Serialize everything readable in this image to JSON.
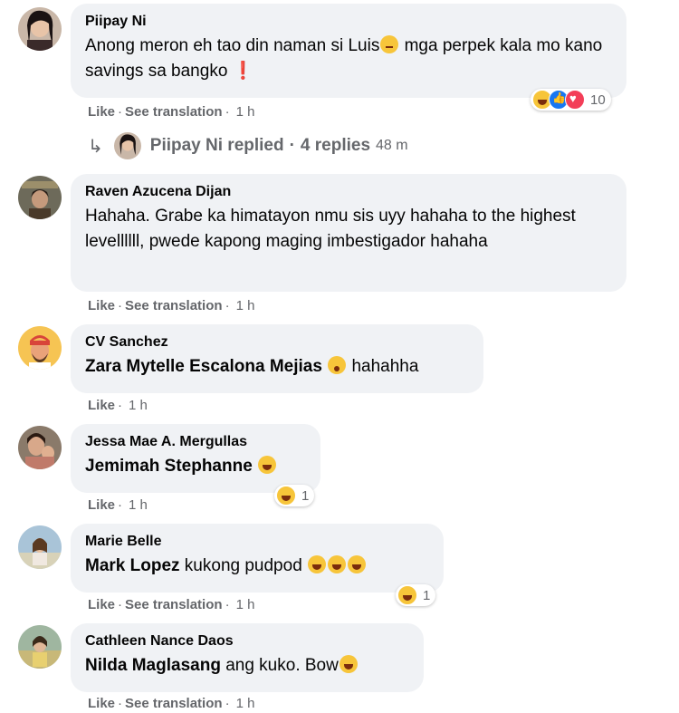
{
  "comments": [
    {
      "author": "Piipay Ni",
      "text_before": "Anong meron eh tao din naman si Luis",
      "text_after": " mga perpek kala mo kano savings sa bangko",
      "trailing": "❗",
      "reactions_count": "10",
      "actions": {
        "like": "Like",
        "translate": "See translation",
        "time": "1 h"
      },
      "reply_summary": {
        "author": "Piipay Ni replied",
        "replies": "4 replies",
        "time": "48 m"
      }
    },
    {
      "author": "Raven Azucena Dijan",
      "text": "Hahaha. Grabe ka himatayon nmu sis uyy hahaha to the highest levellllll, pwede kapong maging imbestigador hahaha",
      "actions": {
        "like": "Like",
        "translate": "See translation",
        "time": "1 h"
      }
    },
    {
      "author": "CV Sanchez",
      "mention": "Zara Mytelle Escalona Mejias",
      "text": " hahahha",
      "actions": {
        "like": "Like",
        "time": "1 h"
      }
    },
    {
      "author": "Jessa Mae A. Mergullas",
      "mention": "Jemimah Stephanne",
      "reactions_count": "1",
      "actions": {
        "like": "Like",
        "time": "1 h"
      }
    },
    {
      "author": "Marie Belle",
      "mention": "Mark Lopez",
      "text": " kukong pudpod ",
      "reactions_count": "1",
      "actions": {
        "like": "Like",
        "translate": "See translation",
        "time": "1 h"
      }
    },
    {
      "author": "Cathleen Nance Daos",
      "mention": "Nilda Maglasang",
      "text": " ang kuko. Bow",
      "actions": {
        "like": "Like",
        "translate": "See translation",
        "time": "1 h"
      }
    }
  ],
  "colors": {
    "bubble": "#f0f2f5",
    "meta": "#65676b",
    "haha": "#f7c53a",
    "like": "#1877f2",
    "love": "#f33e58"
  }
}
